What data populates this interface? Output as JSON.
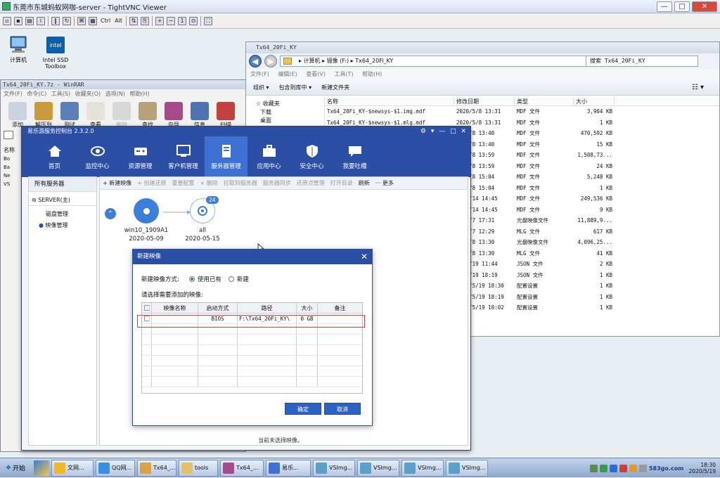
{
  "vnc": {
    "title": "东莞市东城蚂蚁网咖-server - TightVNC Viewer",
    "toolbar_text": [
      "Ctrl",
      "Alt"
    ]
  },
  "desktop_icons": [
    {
      "label": "计算机",
      "icon": "computer-icon"
    },
    {
      "label": "Intel SSD\nToolbox",
      "icon": "intel-ssd-icon"
    }
  ],
  "winrar": {
    "title": "Tx64_20Fi_KY.7z - WinRAR",
    "menu": "文件(F) 命令(C) 工具(S) 收藏夹(O) 选项(N) 帮助(H)",
    "tools": [
      "添加",
      "解压到",
      "测试",
      "查看",
      "删除",
      "查找",
      "向导",
      "信息",
      "扫描"
    ],
    "side_label": "名称",
    "side_items": [
      "Bo",
      "Ba",
      "Ne",
      "VS"
    ]
  },
  "explorer": {
    "title": "Tx64_20Fi_KY",
    "address": "▸ 计算机 ▸ 镜像 (F:) ▸ Tx64_20Fi_KY",
    "search": "搜索 Tx64_20Fi_KY",
    "menu": "文件(F) 编辑(E) 查看(V) 工具(T) 帮助(H)",
    "cmd": [
      "组织 ▾",
      "包含到库中 ▾",
      "新建文件夹"
    ],
    "nav": [
      "收藏夹",
      "下载",
      "桌面"
    ],
    "headers": [
      "名称",
      "修改日期",
      "类型",
      "大小"
    ],
    "files": [
      {
        "name": "Tx64_20Fi_KY-$newsys-$1.img.mdf",
        "date": "2020/5/8 13:31",
        "type": "MDF 文件",
        "size": "3,904 KB"
      },
      {
        "name": "Tx64_20Fi_KY-$newsys-$1.mlg.mdf",
        "date": "2020/5/8 13:31",
        "type": "MDF 文件",
        "size": "1 KB"
      },
      {
        "name": "",
        "date": "20/5/8 13:40",
        "type": "MDF 文件",
        "size": "470,592 KB"
      },
      {
        "name": "",
        "date": "20/5/8 13:40",
        "type": "MDF 文件",
        "size": "15 KB"
      },
      {
        "name": "",
        "date": "20/5/8 13:59",
        "type": "MDF 文件",
        "size": "1,508,73..."
      },
      {
        "name": "",
        "date": "20/5/8 13:59",
        "type": "MDF 文件",
        "size": "24 KB"
      },
      {
        "name": "",
        "date": "20/5/8 15:04",
        "type": "MDF 文件",
        "size": "5,248 KB"
      },
      {
        "name": "",
        "date": "20/5/8 15:04",
        "type": "MDF 文件",
        "size": "1 KB"
      },
      {
        "name": "",
        "date": "20/5/14 14:45",
        "type": "MDF 文件",
        "size": "249,536 KB"
      },
      {
        "name": "",
        "date": "20/5/14 14:45",
        "type": "MDF 文件",
        "size": "9 KB"
      },
      {
        "name": "",
        "date": "20/3/7 17:31",
        "type": "光盘映像文件",
        "size": "11,889,9..."
      },
      {
        "name": "",
        "date": "20/3/7 12:29",
        "type": "MLG 文件",
        "size": "617 KB"
      },
      {
        "name": "",
        "date": "20/5/8 13:30",
        "type": "光盘映像文件",
        "size": "4,096,25..."
      },
      {
        "name": "",
        "date": "20/5/8 13:30",
        "type": "MLG 文件",
        "size": "41 KB"
      },
      {
        "name": "",
        "date": "20/5/19 11:44",
        "type": "JSON 文件",
        "size": "2 KB"
      },
      {
        "name": "",
        "date": "20/5/19 18:19",
        "type": "JSON 文件",
        "size": "1 KB"
      },
      {
        "name": "",
        "date": "2020/5/19 18:30",
        "type": "配置设置",
        "size": "1 KB"
      },
      {
        "name": "",
        "date": "2020/5/19 18:19",
        "type": "配置设置",
        "size": "1 KB"
      },
      {
        "name": "",
        "date": "2020/5/19 18:02",
        "type": "配置设置",
        "size": "1 KB"
      }
    ]
  },
  "console": {
    "title": "易乐游服务控制台 2.3.2.0",
    "nav": [
      {
        "label": "首页",
        "icon": "home-icon"
      },
      {
        "label": "监控中心",
        "icon": "eye-icon"
      },
      {
        "label": "资源管理",
        "icon": "gamepad-icon"
      },
      {
        "label": "客户机管理",
        "icon": "monitor-icon"
      },
      {
        "label": "服务器管理",
        "icon": "server-icon"
      },
      {
        "label": "应用中心",
        "icon": "toolbox-icon"
      },
      {
        "label": "安全中心",
        "icon": "shield-icon"
      },
      {
        "label": "我要吐槽",
        "icon": "chat-icon"
      }
    ],
    "tree_header": "所有服务器",
    "server": "SERVER(主)",
    "tree_items": [
      "磁盘管理",
      "映像管理"
    ],
    "toolbar": [
      "+ 新建映像",
      "+ 创建还原",
      "重要配置",
      "× 删除",
      "拉取到服务器",
      "服务器同步",
      "还原点管理",
      "打开目录",
      "刷新",
      "··· 更多"
    ],
    "nodes": [
      {
        "name": "win10_1909A1",
        "date": "2020-05-09"
      },
      {
        "name": "all",
        "date": "2020-05-15",
        "badge": "24"
      }
    ],
    "status": "当前未选择映像。"
  },
  "dialog": {
    "title": "新建映像",
    "mode_label": "新建映像方式:",
    "opt1": "使用已有",
    "opt2": "新建",
    "select_label": "请选择需要添加的映像:",
    "headers": [
      "映像名称",
      "启动方式",
      "路径",
      "大小",
      "备注"
    ],
    "row": {
      "name": "",
      "boot": "BIOS",
      "path": "F:\\Tx64_20Fi_KY\\",
      "size": "0 GB",
      "note": ""
    },
    "ok": "确定",
    "cancel": "取消"
  },
  "taskbar": {
    "start": "开始",
    "buttons": [
      "文网...",
      "QQ网...",
      "Tx64_...",
      "tools",
      "Tx64_...",
      "易乐...",
      "VSImg...",
      "VSImg...",
      "VSImg...",
      "VSImg..."
    ],
    "clock_time": "18:30",
    "clock_date": "2020/5/19",
    "watermark": "583go.com"
  }
}
